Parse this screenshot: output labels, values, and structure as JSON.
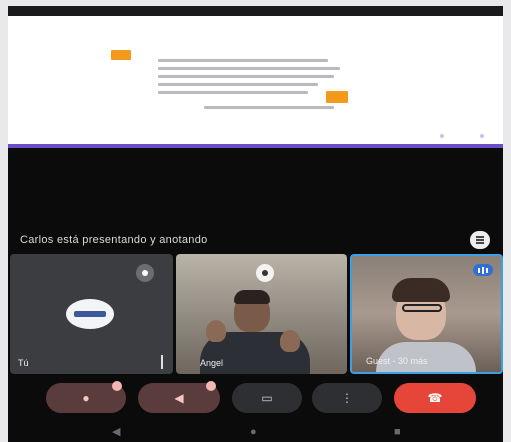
{
  "presentation": {
    "status_text": "Carlos está presentando y anotando"
  },
  "participants": [
    {
      "name": "Tú"
    },
    {
      "name": "Angel"
    },
    {
      "name": "Guest - 30 más"
    }
  ],
  "icons": {
    "more_options": "more-vert-icon",
    "mic": "mic-off-icon",
    "camera": "camera-off-icon",
    "captions": "captions-icon",
    "more": "more-vert-icon",
    "end_call": "call-end-icon",
    "back": "back-nav-icon",
    "home": "home-nav-icon",
    "recents": "recents-nav-icon"
  },
  "colors": {
    "accent": "#6a4fc8",
    "slide_tag": "#f39a1d",
    "end_call": "#e6463a",
    "active_speaker": "#3da0e6"
  }
}
